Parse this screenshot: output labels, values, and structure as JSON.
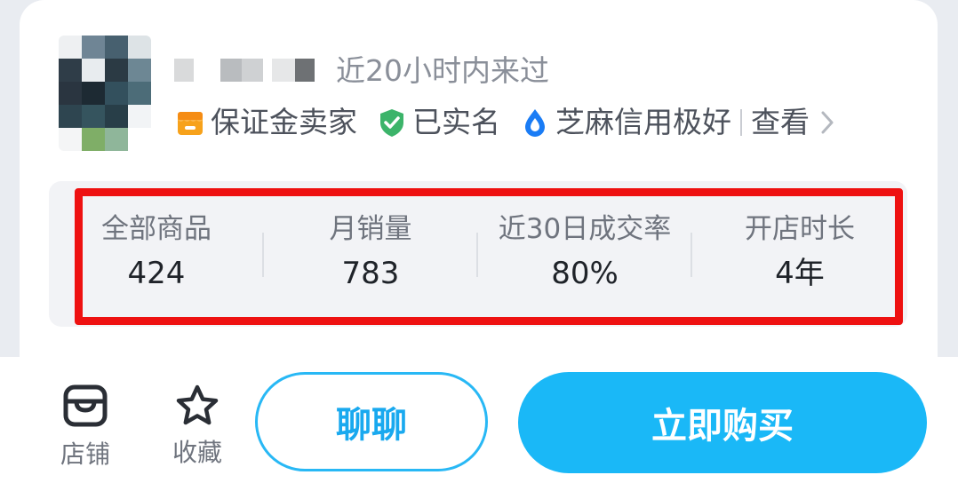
{
  "seller": {
    "last_seen": "近20小时内来过",
    "badges": [
      {
        "label": "保证金卖家",
        "icon": "shop-deposit-icon",
        "color": "#f7a21b"
      },
      {
        "label": "已实名",
        "icon": "verified-shield-icon",
        "color": "#3cb46a"
      },
      {
        "label": "芝麻信用极好",
        "icon": "sesame-credit-drop-icon",
        "color": "#1a7cf5"
      }
    ],
    "view_more": "查看"
  },
  "stats": [
    {
      "label": "全部商品",
      "value": "424"
    },
    {
      "label": "月销量",
      "value": "783"
    },
    {
      "label": "近30日成交率",
      "value": "80%"
    },
    {
      "label": "开店时长",
      "value": "4年"
    }
  ],
  "bottom_bar": {
    "shop_label": "店铺",
    "favorite_label": "收藏",
    "chat_label": "聊聊",
    "buy_label": "立即购买"
  },
  "colors": {
    "accent": "#1ab8f7",
    "highlight_border": "#ee1111"
  }
}
